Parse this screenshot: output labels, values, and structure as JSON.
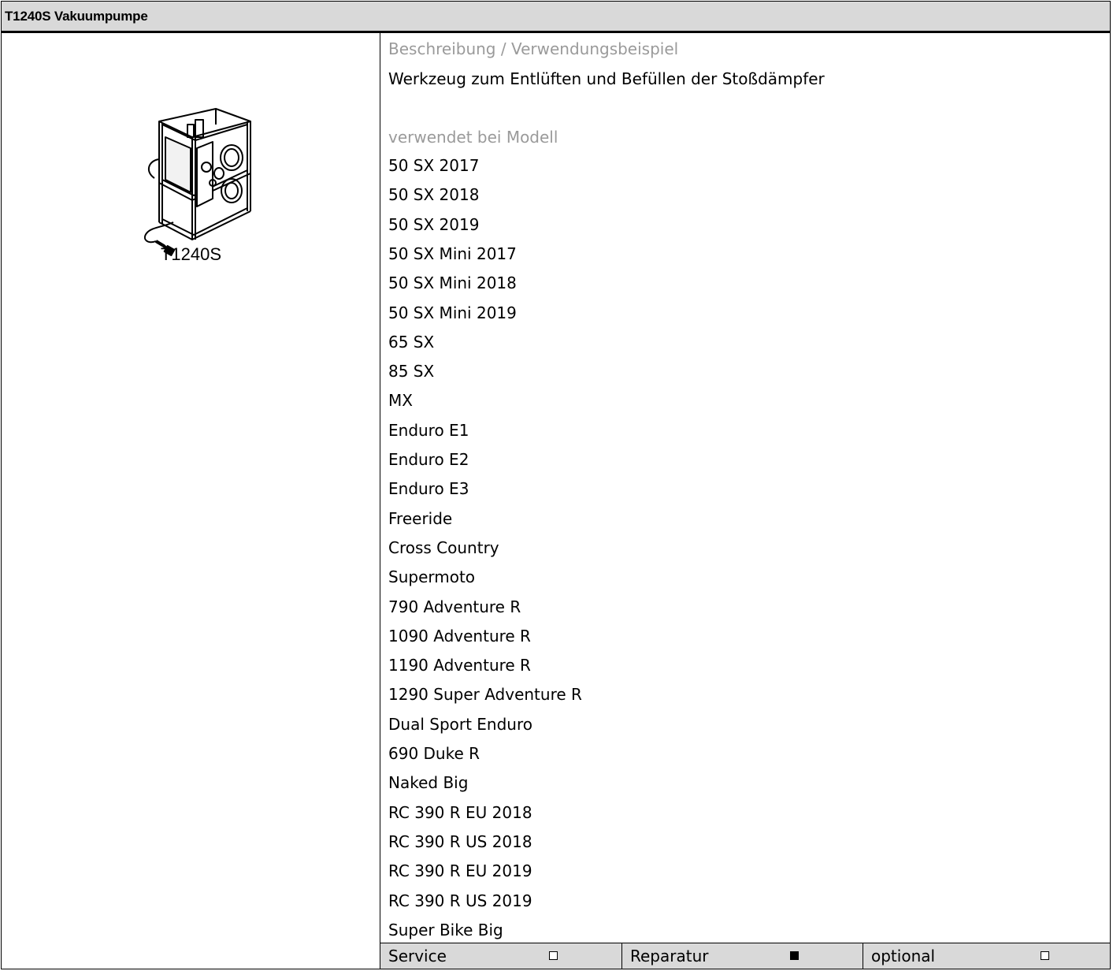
{
  "header": {
    "title": "T1240S Vakuumpumpe"
  },
  "tool": {
    "caption": "T1240S",
    "image_icon": "vacuum-pump-drawing"
  },
  "description": {
    "label": "Beschreibung / Verwendungsbeispiel",
    "text": "Werkzeug zum Entlüften und Befüllen der Stoßdämpfer"
  },
  "models": {
    "label": "verwendet bei Modell",
    "items": [
      "50 SX 2017",
      "50 SX 2018",
      "50 SX 2019",
      "50 SX Mini 2017",
      "50 SX Mini 2018",
      "50 SX Mini 2019",
      "65 SX",
      "85 SX",
      "MX",
      "Enduro E1",
      "Enduro E2",
      "Enduro E3",
      "Freeride",
      "Cross Country",
      "Supermoto",
      "790 Adventure R",
      "1090 Adventure R",
      "1190 Adventure R",
      "1290 Super Adventure R",
      "Dual Sport Enduro",
      "690 Duke R",
      "Naked Big",
      "RC 390 R EU 2018",
      "RC 390 R US 2018",
      "RC 390 R EU 2019",
      "RC 390 R US 2019",
      "Super Bike Big"
    ]
  },
  "footer": {
    "categories": [
      {
        "label": "Service",
        "checked": false
      },
      {
        "label": "Reparatur",
        "checked": true
      },
      {
        "label": "optional",
        "checked": false
      }
    ]
  }
}
